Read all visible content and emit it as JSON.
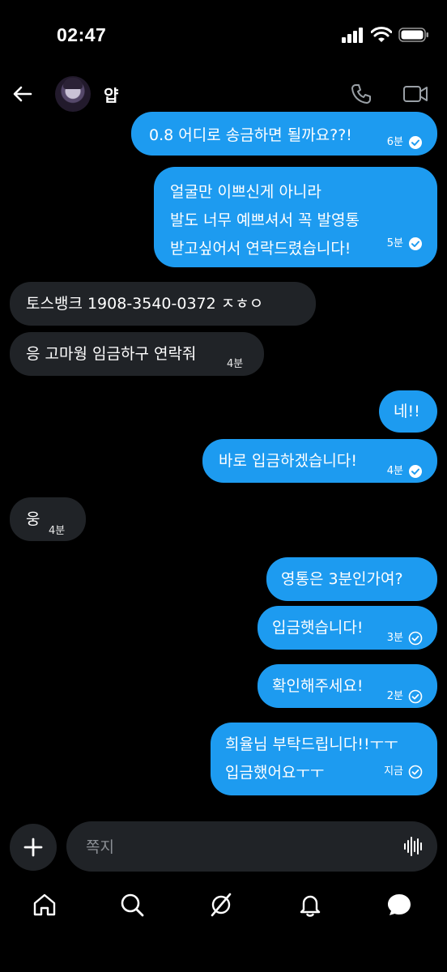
{
  "status_bar": {
    "time": "02:47"
  },
  "header": {
    "name": "얍"
  },
  "messages": [
    {
      "text_lines": [
        "0.8 어디로 송금하면 될까요??!"
      ],
      "time": "6분",
      "sent": true
    },
    {
      "text_lines": [
        "얼굴만 이쁘신게 아니라",
        "발도 너무 예쁘셔서 꼭 발영통",
        "받고싶어서 연락드렸습니다!"
      ],
      "time": "5분",
      "sent": true
    },
    {
      "text_lines": [
        "토스뱅크 1908-3540-0372 ㅈㅎㅇ"
      ],
      "time": "",
      "sent": false
    },
    {
      "text_lines": [
        "응 고마웡 임금하구 연락줘"
      ],
      "time": "4분",
      "sent": false
    },
    {
      "text_lines": [
        "네!!"
      ],
      "time": "",
      "sent": true
    },
    {
      "text_lines": [
        "바로 입금하겠습니다!"
      ],
      "time": "4분",
      "sent": true
    },
    {
      "text_lines": [
        "웅"
      ],
      "time": "4분",
      "sent": false
    },
    {
      "text_lines": [
        "영통은 3분인가여?"
      ],
      "time": "",
      "sent": true
    },
    {
      "text_lines": [
        "입금햇습니다!"
      ],
      "time": "3분",
      "sent": true
    },
    {
      "text_lines": [
        "확인해주세요!"
      ],
      "time": "2분",
      "sent": true
    },
    {
      "text_lines": [
        "희율님 부탁드립니다!!ㅜㅜ",
        "입금했어요ㅜㅜ"
      ],
      "time": "지금",
      "sent": true
    }
  ],
  "composer": {
    "placeholder": "쪽지"
  },
  "icons": {
    "back": "arrow-left-icon",
    "phone": "phone-icon",
    "video": "video-icon",
    "plus": "plus-icon",
    "voice": "voice-wave-icon",
    "nav": [
      "home-icon",
      "search-icon",
      "grok-icon",
      "bell-icon",
      "messages-icon"
    ]
  },
  "colors": {
    "sent_bubble": "#1d9bf0",
    "received_bubble": "#202327",
    "background": "#000000"
  }
}
